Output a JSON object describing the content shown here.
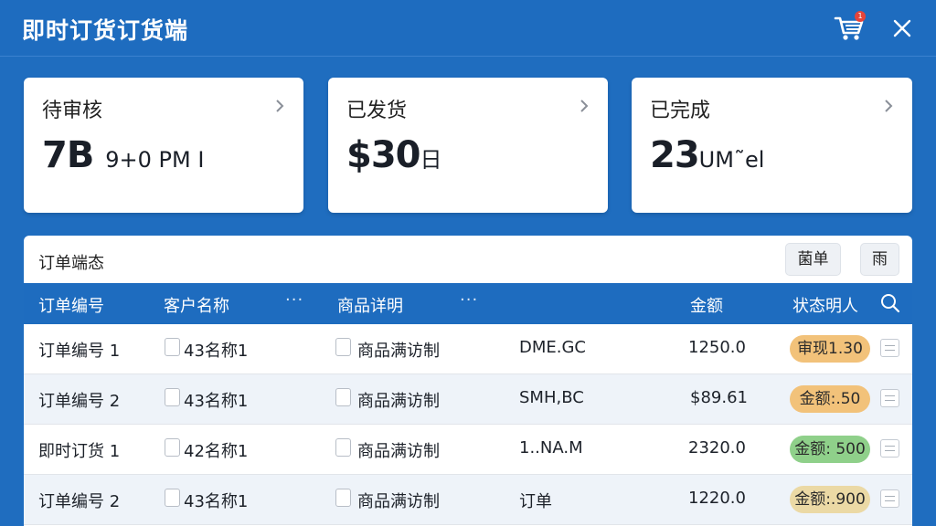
{
  "app": {
    "title": "即时订货订货端",
    "cart_badge": "1"
  },
  "colors": {
    "primary": "#1e6cbf",
    "pill_orange": "#f2c27a",
    "pill_green": "#8fd08a",
    "pill_tan": "#ebd9a5"
  },
  "cards": [
    {
      "label": "待审核",
      "value": "7B",
      "suffix": "9+0 PM I"
    },
    {
      "label": "已发货",
      "value": "$30",
      "suffix": "日"
    },
    {
      "label": "已完成",
      "value": "23",
      "suffix": "UM˜el"
    }
  ],
  "panel": {
    "title": "订单端态",
    "button_1": "菌单",
    "button_2": "雨"
  },
  "table": {
    "headers": {
      "order_no": "订单编号",
      "customer": "客户名称",
      "detail": "商品详明",
      "amount": "金额",
      "status": "状态明人"
    },
    "dots": "···",
    "rows": [
      {
        "order_no": "订单编号 1",
        "customer": "43名称1",
        "detail": "商品满访制",
        "code": "DME.GC",
        "amount": "1250.0",
        "status": "审现1.30",
        "status_color": "#f2c27a"
      },
      {
        "order_no": "订单编号 2",
        "customer": "43名称1",
        "detail": "商品满访制",
        "code": "SMH,BC",
        "amount": "$89.61",
        "status": "金额:.50",
        "status_color": "#f2c27a"
      },
      {
        "order_no": "即时订货 1",
        "customer": "42名称1",
        "detail": "商品满访制",
        "code": "1..NA.M",
        "amount": "2320.0",
        "status": "金额: 500",
        "status_color": "#8fd08a"
      },
      {
        "order_no": "订单编号 2",
        "customer": "43名称1",
        "detail": "商品满访制",
        "code": "订单",
        "amount": "1220.0",
        "status": "金额:.900",
        "status_color": "#ebd9a5"
      }
    ]
  }
}
